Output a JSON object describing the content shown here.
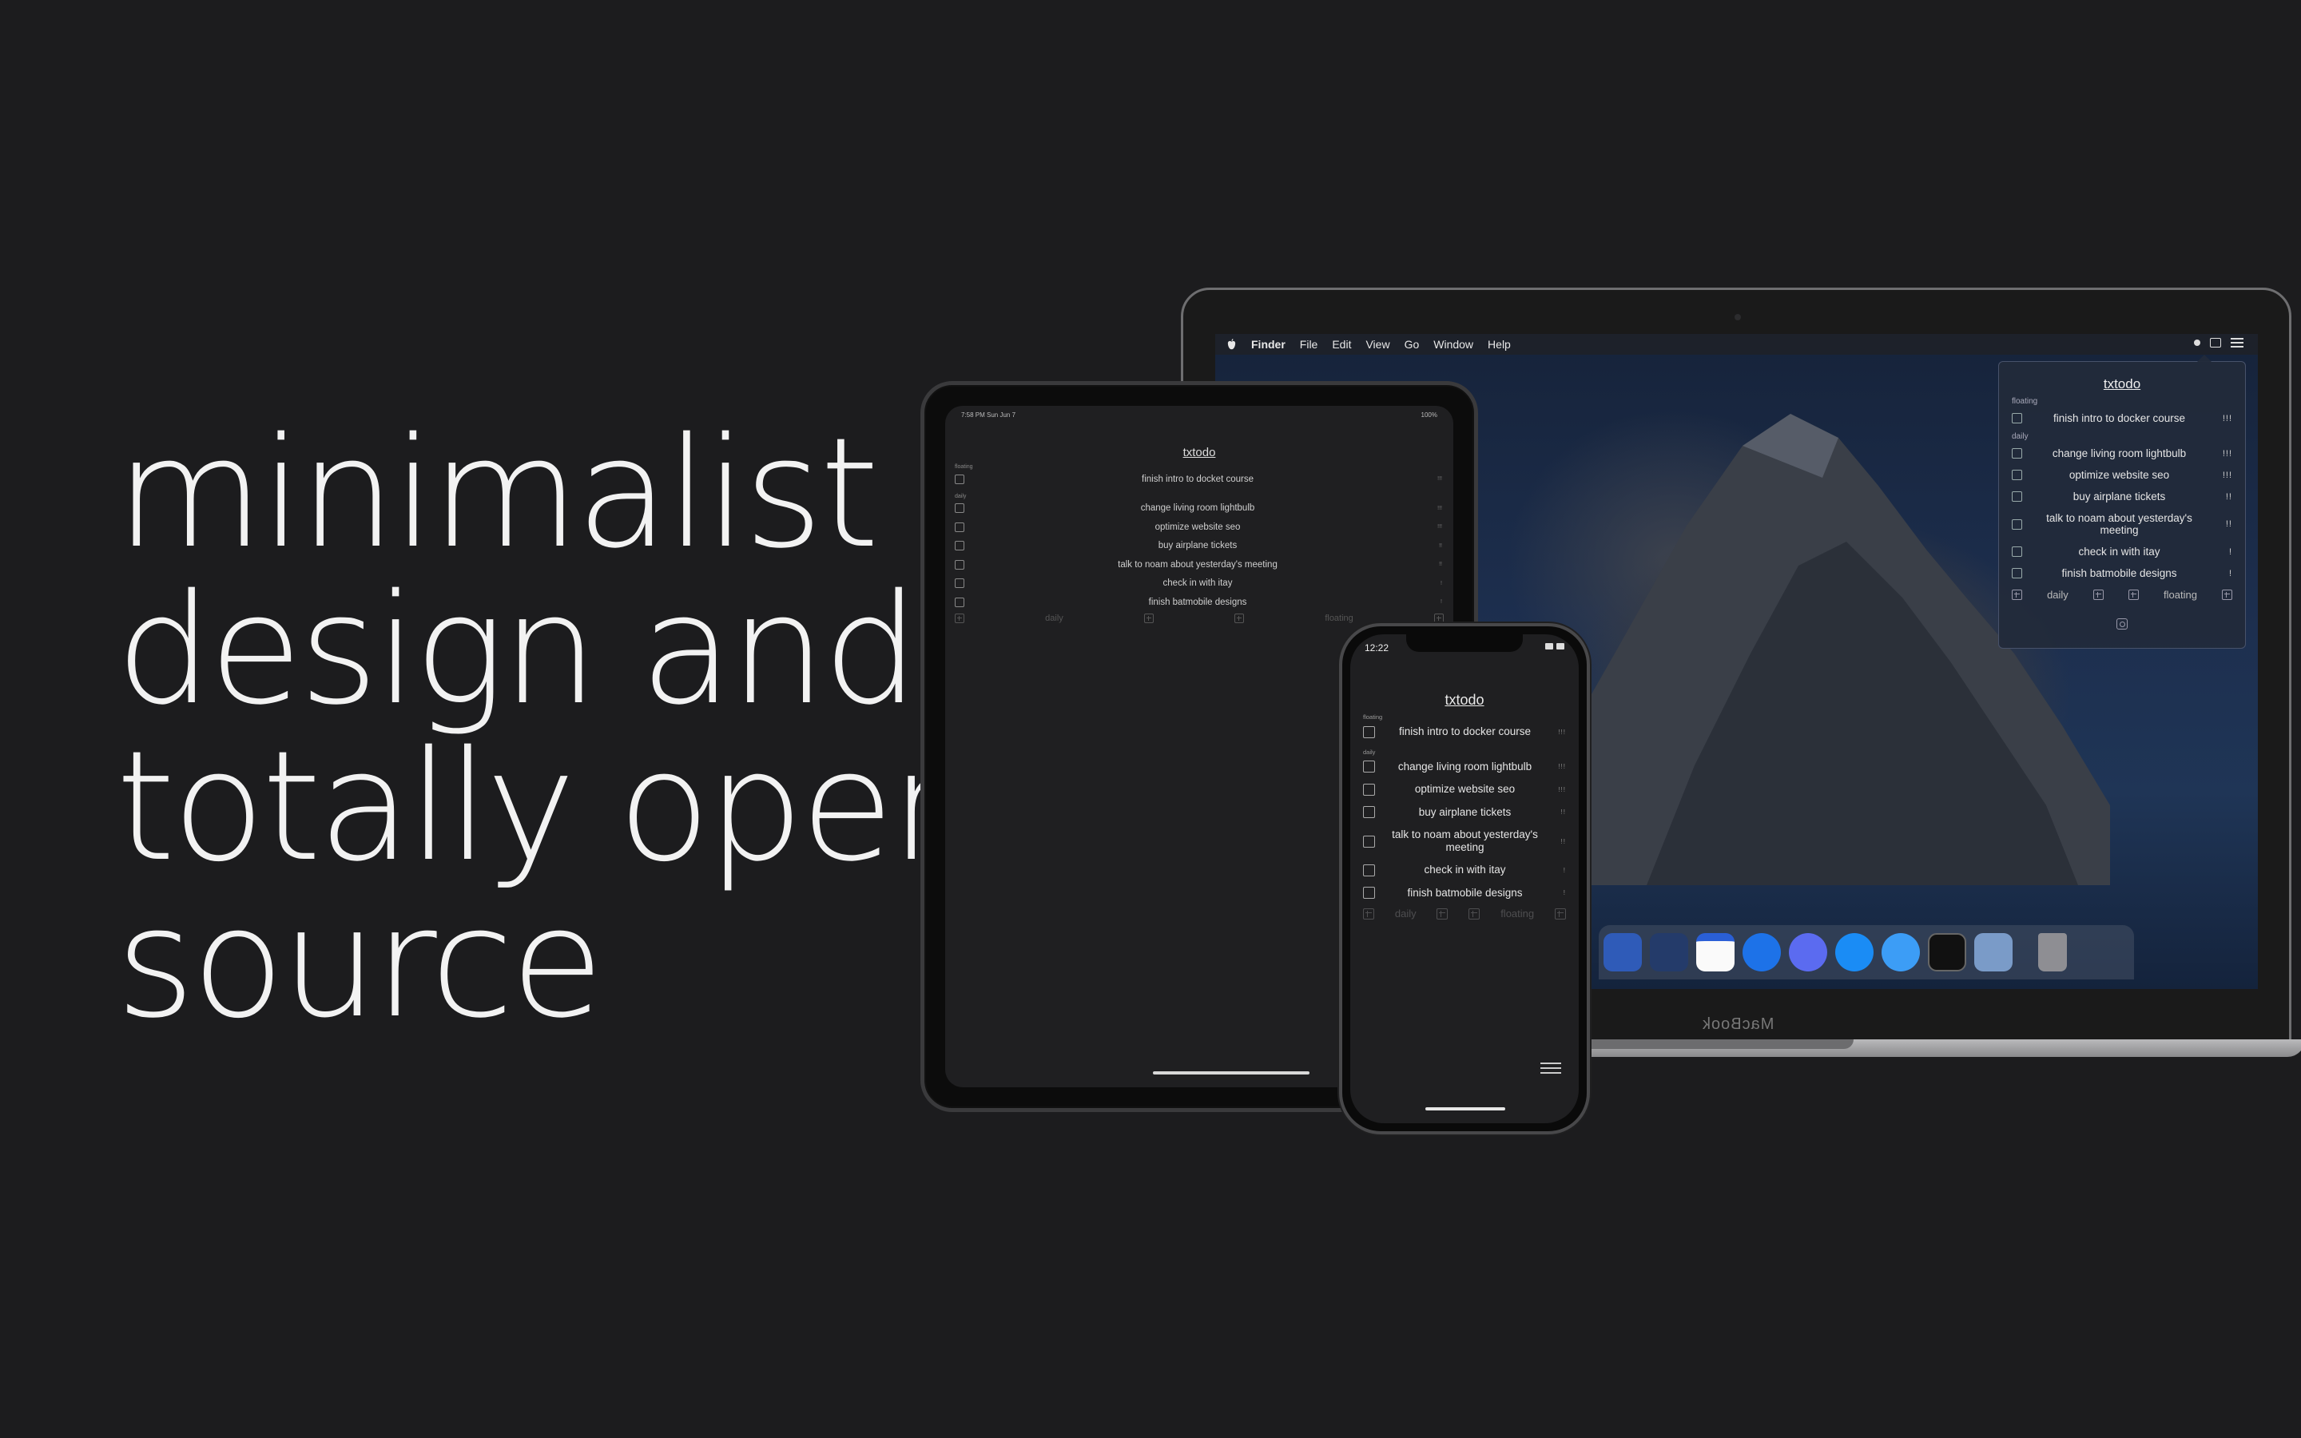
{
  "headline": {
    "line1": "minimalist",
    "line2": "design and",
    "line3": "totally open",
    "line4": "source"
  },
  "mac": {
    "menubar": {
      "app": "Finder",
      "items": [
        "File",
        "Edit",
        "View",
        "Go",
        "Window",
        "Help"
      ]
    },
    "brand_label": "MacBook",
    "popover": {
      "title": "txtodo",
      "floating_label": "floating",
      "daily_label": "daily",
      "floating_tasks": [
        {
          "text": "finish intro to docker course",
          "priority": "!!!"
        }
      ],
      "daily_tasks": [
        {
          "text": "change living room lightbulb",
          "priority": "!!!"
        },
        {
          "text": "optimize website seo",
          "priority": "!!!"
        },
        {
          "text": "buy airplane tickets",
          "priority": "!!"
        },
        {
          "text": "talk to noam about yesterday's meeting",
          "priority": "!!"
        },
        {
          "text": "check in with itay",
          "priority": "!"
        },
        {
          "text": "finish batmobile designs",
          "priority": "!"
        }
      ],
      "footer": {
        "daily": "daily",
        "floating": "floating"
      }
    },
    "dock_icons": [
      "bitwarden-icon",
      "xcode-icon",
      "calendar-icon",
      "signal-icon",
      "discord-icon",
      "app-store-icon",
      "messages-icon",
      "terminal-icon",
      "preview-icon",
      "trash-icon"
    ]
  },
  "ipad": {
    "status_time": "7:58 PM   Sun Jun 7",
    "status_battery": "100%",
    "title": "txtodo",
    "floating_label": "floating",
    "daily_label": "daily",
    "floating_tasks": [
      {
        "text": "finish intro to docket course",
        "priority": "!!!"
      }
    ],
    "daily_tasks": [
      {
        "text": "change living room lightbulb",
        "priority": "!!!"
      },
      {
        "text": "optimize website seo",
        "priority": "!!!"
      },
      {
        "text": "buy airplane tickets",
        "priority": "!!"
      },
      {
        "text": "talk to noam about yesterday's meeting",
        "priority": "!!"
      },
      {
        "text": "check in with itay",
        "priority": "!"
      },
      {
        "text": "finish batmobile designs",
        "priority": "!"
      }
    ],
    "footer": {
      "daily": "daily",
      "floating": "floating"
    }
  },
  "iphone": {
    "status_time": "12:22",
    "title": "txtodo",
    "floating_label": "floating",
    "daily_label": "daily",
    "floating_tasks": [
      {
        "text": "finish intro to docker course",
        "priority": "!!!"
      }
    ],
    "daily_tasks": [
      {
        "text": "change living room lightbulb",
        "priority": "!!!"
      },
      {
        "text": "optimize website seo",
        "priority": "!!!"
      },
      {
        "text": "buy airplane tickets",
        "priority": "!!"
      },
      {
        "text": "talk to noam about yesterday's meeting",
        "priority": "!!"
      },
      {
        "text": "check in with itay",
        "priority": "!"
      },
      {
        "text": "finish batmobile designs",
        "priority": "!"
      }
    ],
    "footer": {
      "daily": "daily",
      "floating": "floating"
    }
  }
}
